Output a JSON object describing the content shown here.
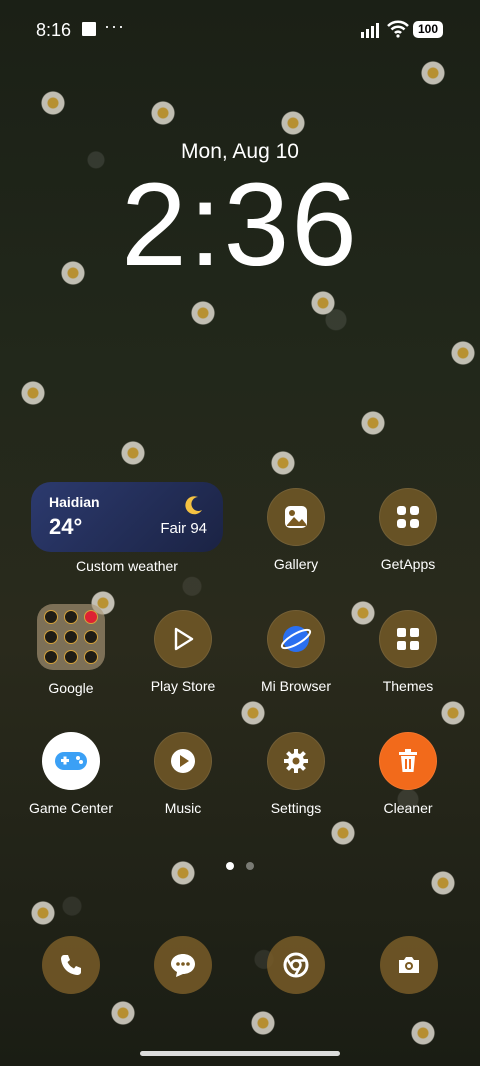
{
  "status_bar": {
    "time": "8:16",
    "dots": "···",
    "battery": "100"
  },
  "lock_clock": {
    "date": "Mon, Aug 10",
    "time": "2:36"
  },
  "weather_widget": {
    "city": "Haidian",
    "temperature": "24°",
    "condition": "Fair 94",
    "label": "Custom weather",
    "icon": "moon-icon"
  },
  "apps": {
    "gallery": "Gallery",
    "getapps": "GetApps",
    "google": "Google",
    "play_store": "Play Store",
    "mi_browser": "Mi Browser",
    "themes": "Themes",
    "game_center": "Game Center",
    "music": "Music",
    "settings": "Settings",
    "cleaner": "Cleaner"
  },
  "dock": [
    "phone-icon",
    "messages-icon",
    "chrome-icon",
    "camera-icon"
  ],
  "page_indicator": {
    "pages": 2,
    "current": 1
  },
  "colors": {
    "accent_icon_bg": "#785c28",
    "weather_bg": "#2c3a6e",
    "cleaner_accent": "#f26a1b"
  }
}
